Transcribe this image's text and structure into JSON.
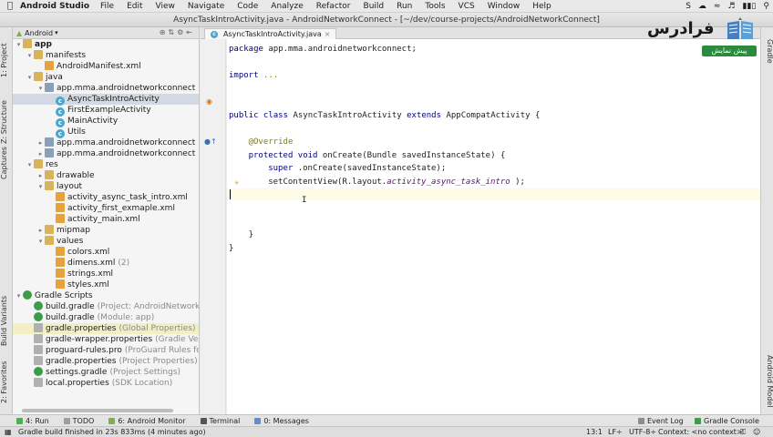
{
  "menubar": {
    "app_name": "Android Studio",
    "items": [
      "File",
      "Edit",
      "View",
      "Navigate",
      "Code",
      "Analyze",
      "Refactor",
      "Build",
      "Run",
      "Tools",
      "VCS",
      "Window",
      "Help"
    ]
  },
  "window": {
    "title": "AsyncTaskIntroActivity.java - AndroidNetworkConnect - [~/dev/course-projects/AndroidNetworkConnect]"
  },
  "left_stripe": {
    "project": "1: Project",
    "structure": "Z: Structure",
    "captures": "Captures",
    "build_variants": "Build Variants",
    "favorites": "2: Favorites"
  },
  "right_stripe": {
    "gradle": "Gradle",
    "android_model": "Android Model"
  },
  "project_panel": {
    "view_mode": "Android",
    "tree": [
      {
        "label": "app",
        "icon": "module",
        "depth": 0,
        "expanded": true
      },
      {
        "label": "manifests",
        "icon": "folder",
        "depth": 1,
        "expanded": true
      },
      {
        "label": "AndroidManifest.xml",
        "icon": "xml",
        "depth": 2
      },
      {
        "label": "java",
        "icon": "folder",
        "depth": 1,
        "expanded": true
      },
      {
        "label": "app.mma.androidnetworkconnect",
        "icon": "package",
        "depth": 2,
        "expanded": true
      },
      {
        "label": "AsyncTaskIntroActivity",
        "icon": "class",
        "depth": 3,
        "selected": true
      },
      {
        "label": "FirstExampleActivity",
        "icon": "class",
        "depth": 3
      },
      {
        "label": "MainActivity",
        "icon": "class",
        "depth": 3
      },
      {
        "label": "Utils",
        "icon": "class",
        "depth": 3
      },
      {
        "label": "app.mma.androidnetworkconnect",
        "note": "(a",
        "icon": "package",
        "depth": 2
      },
      {
        "label": "app.mma.androidnetworkconnect",
        "note": "(te",
        "icon": "package",
        "depth": 2
      },
      {
        "label": "res",
        "icon": "folder",
        "depth": 1,
        "expanded": true
      },
      {
        "label": "drawable",
        "icon": "folder",
        "depth": 2
      },
      {
        "label": "layout",
        "icon": "folder",
        "depth": 2,
        "expanded": true
      },
      {
        "label": "activity_async_task_intro.xml",
        "icon": "xml",
        "depth": 3
      },
      {
        "label": "activity_first_exmaple.xml",
        "icon": "xml",
        "depth": 3
      },
      {
        "label": "activity_main.xml",
        "icon": "xml",
        "depth": 3
      },
      {
        "label": "mipmap",
        "icon": "folder",
        "depth": 2
      },
      {
        "label": "values",
        "icon": "folder",
        "depth": 2,
        "expanded": true
      },
      {
        "label": "colors.xml",
        "icon": "xml",
        "depth": 3
      },
      {
        "label": "dimens.xml",
        "note": "(2)",
        "icon": "xml",
        "depth": 3
      },
      {
        "label": "strings.xml",
        "icon": "xml",
        "depth": 3
      },
      {
        "label": "styles.xml",
        "icon": "xml",
        "depth": 3
      },
      {
        "label": "Gradle Scripts",
        "icon": "gradle",
        "depth": 0,
        "expanded": true
      },
      {
        "label": "build.gradle",
        "note": "(Project: AndroidNetworkCo",
        "icon": "gradle",
        "depth": 1
      },
      {
        "label": "build.gradle",
        "note": "(Module: app)",
        "icon": "gradle",
        "depth": 1
      },
      {
        "label": "gradle.properties",
        "note": "(Global Properties)",
        "icon": "prop",
        "depth": 1,
        "highlight": true
      },
      {
        "label": "gradle-wrapper.properties",
        "note": "(Gradle Versi",
        "icon": "prop",
        "depth": 1
      },
      {
        "label": "proguard-rules.pro",
        "note": "(ProGuard Rules fo",
        "icon": "prop",
        "depth": 1
      },
      {
        "label": "gradle.properties",
        "note": "(Project Properties)",
        "icon": "prop",
        "depth": 1
      },
      {
        "label": "settings.gradle",
        "note": "(Project Settings)",
        "icon": "gradle",
        "depth": 1
      },
      {
        "label": "local.properties",
        "note": "(SDK Location)",
        "icon": "prop",
        "depth": 1
      }
    ]
  },
  "editor": {
    "tab_label": "AsyncTaskIntroActivity.java",
    "lines": [
      {
        "row": 0,
        "indent": 0,
        "parts": [
          [
            "kw",
            "package"
          ],
          [
            "",
            "app.mma.androidnetworkconnect;"
          ]
        ]
      },
      {
        "row": 2,
        "indent": 0,
        "parts": [
          [
            "kw",
            "import"
          ],
          [
            "ann",
            "..."
          ]
        ]
      },
      {
        "row": 5,
        "indent": 0,
        "parts": [
          [
            "kw",
            "public class"
          ],
          [
            "",
            "AsyncTaskIntroActivity"
          ],
          [
            "kw",
            "extends"
          ],
          [
            "",
            "AppCompatActivity {"
          ]
        ]
      },
      {
        "row": 7,
        "indent": 4,
        "parts": [
          [
            "ann",
            "@Override"
          ]
        ]
      },
      {
        "row": 8,
        "indent": 4,
        "parts": [
          [
            "kw",
            "protected void"
          ],
          [
            "",
            "onCreate(Bundle savedInstanceState) {"
          ]
        ]
      },
      {
        "row": 9,
        "indent": 8,
        "parts": [
          [
            "kw",
            "super"
          ],
          [
            "",
            ".onCreate(savedInstanceState);"
          ]
        ]
      },
      {
        "row": 10,
        "indent": 8,
        "parts": [
          [
            "",
            "setContentView(R.layout."
          ],
          [
            "it",
            "activity_async_task_intro"
          ],
          [
            "",
            ");"
          ]
        ]
      },
      {
        "row": 14,
        "indent": 4,
        "parts": [
          [
            "",
            "}"
          ]
        ]
      },
      {
        "row": 15,
        "indent": 0,
        "parts": [
          [
            "",
            "}"
          ]
        ]
      }
    ]
  },
  "bottom_tools": {
    "run": "4: Run",
    "todo": "TODO",
    "monitor": "6: Android Monitor",
    "terminal": "Terminal",
    "messages": "0: Messages",
    "event_log": "Event Log",
    "gradle_console": "Gradle Console"
  },
  "status": {
    "message": "Gradle build finished in 23s 833ms (4 minutes ago)",
    "position": "13:1",
    "line_sep": "LF÷",
    "encoding": "UTF-8÷",
    "context": "Context: <no context>"
  },
  "watermark": {
    "brand": "فرادرس",
    "sub": "پیش نمایش"
  },
  "colors": {
    "keyword": "#000080",
    "annotation": "#808000",
    "selection": "#d3d9e2",
    "current_line": "#fdfbe6"
  }
}
